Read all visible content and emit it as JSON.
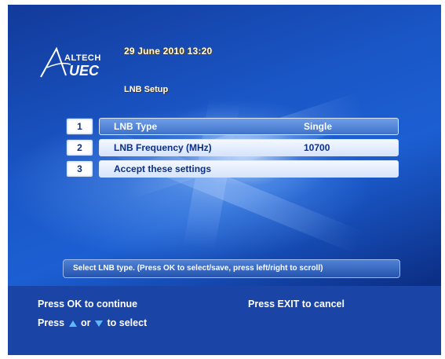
{
  "header": {
    "brand_top": "ALTECH",
    "brand_bottom": "UEC",
    "datetime": "29 June 2010 13:20",
    "screen_title": "LNB Setup"
  },
  "menu": {
    "items": [
      {
        "number": "1",
        "label": "LNB Type",
        "value": "Single",
        "highlighted": true
      },
      {
        "number": "2",
        "label": "LNB Frequency (MHz)",
        "value": "10700",
        "highlighted": false
      },
      {
        "number": "3",
        "label": "Accept these settings",
        "value": "",
        "highlighted": false
      }
    ]
  },
  "help_text": "Select LNB type. (Press OK to select/save, press left/right to scroll)",
  "footer": {
    "continue": "Press OK to continue",
    "cancel": "Press EXIT to cancel",
    "select_prefix": "Press",
    "select_or": "or",
    "select_suffix": "to select"
  },
  "colors": {
    "background": "#1c5fd3",
    "footer": "#1a44a6",
    "highlight_row": "#5589dc",
    "normal_row": "#e8f0fd",
    "arrow": "#5fb8ff"
  },
  "icons": {
    "up": "triangle-up-icon",
    "down": "triangle-down-icon"
  }
}
